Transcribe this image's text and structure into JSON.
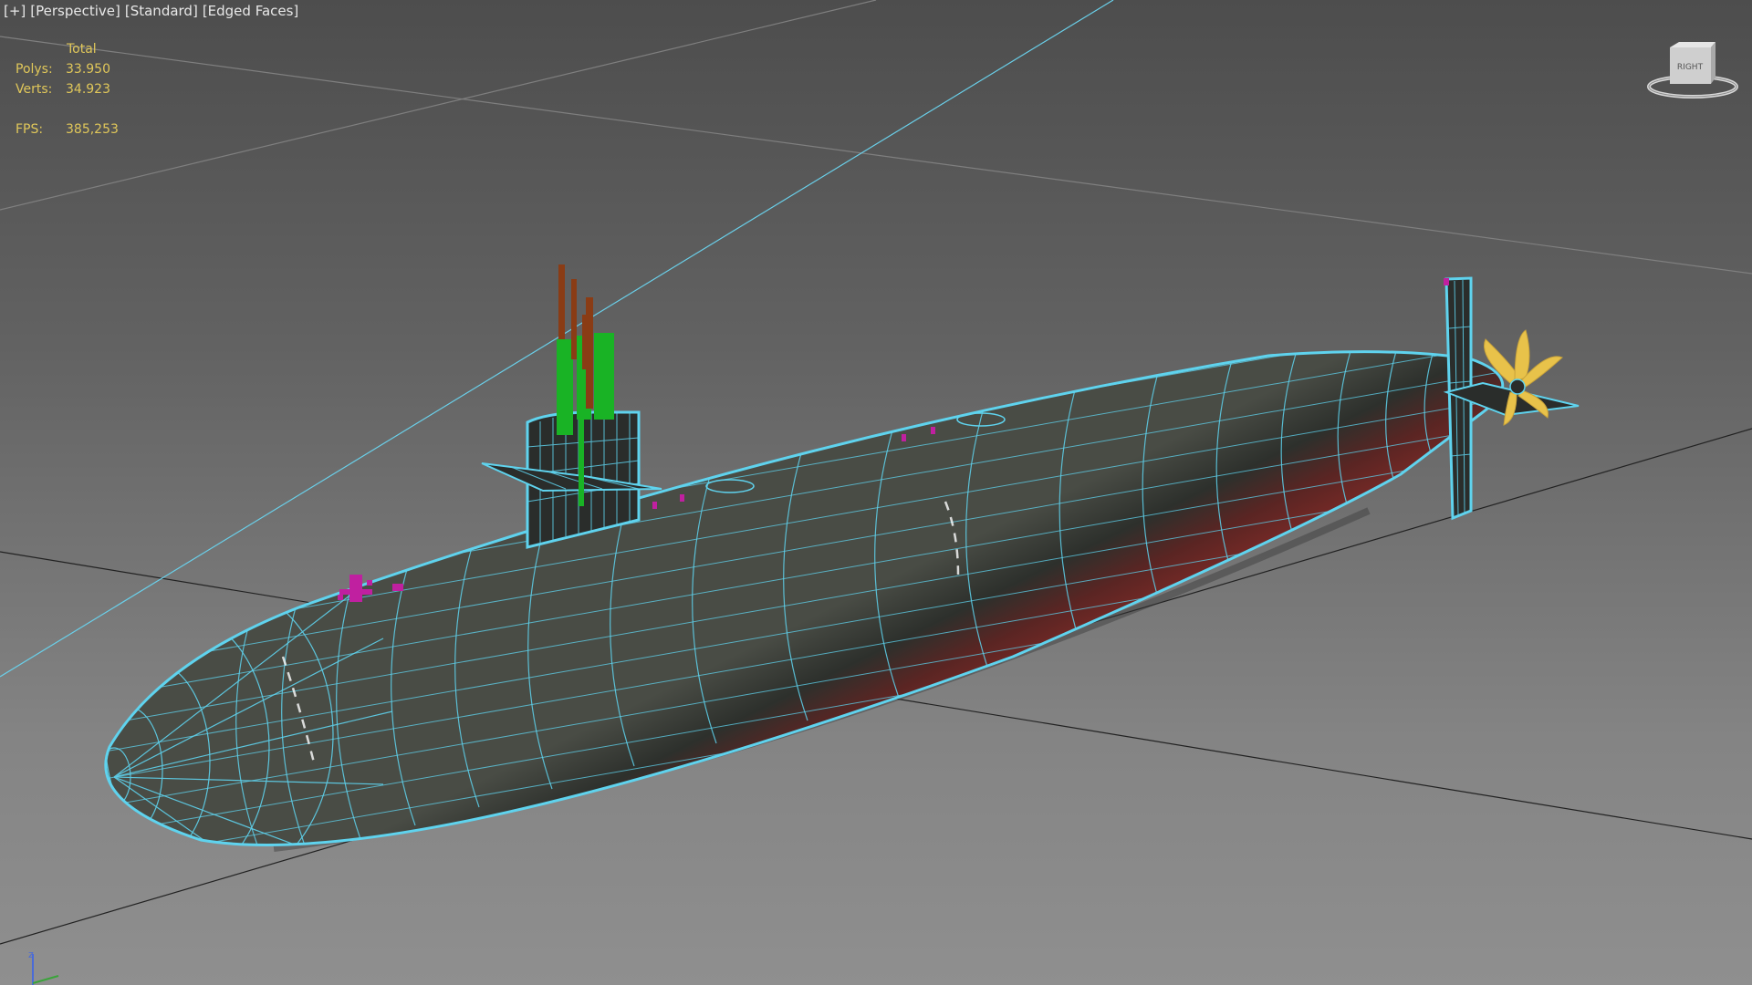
{
  "viewport": {
    "labels": [
      "[+]",
      "[Perspective]",
      "[Standard]",
      "[Edged Faces]"
    ]
  },
  "stats": {
    "header": "Total",
    "polys_label": "Polys:",
    "polys_value": "33.950",
    "verts_label": "Verts:",
    "verts_value": "34.923",
    "fps_label": "FPS:",
    "fps_value": "385,253"
  },
  "viewcube": {
    "face_label": "RIGHT"
  },
  "colors": {
    "stats_text": "#e0c75a",
    "wireframe": "#5fd3ee",
    "hull_dark": "#2e302d",
    "hull_red": "#6b2422",
    "mast_green": "#19b325",
    "mast_brown": "#8a3c15",
    "propeller": "#e8c24a",
    "markers": "#c020a0"
  },
  "icons": [
    "viewcube-icon",
    "axis-gizmo-icon"
  ]
}
